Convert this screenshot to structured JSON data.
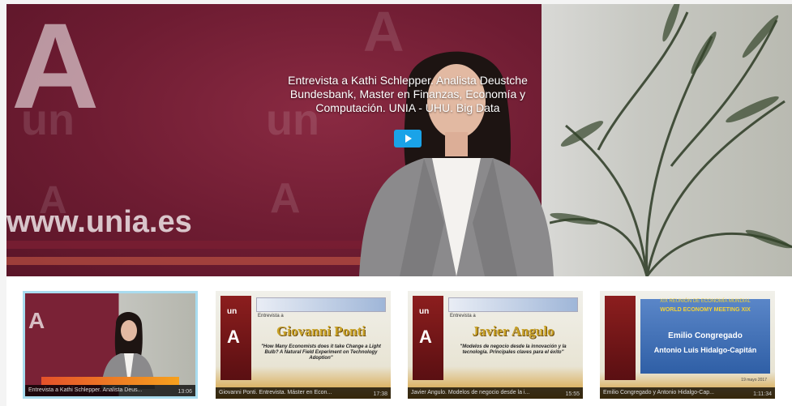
{
  "hero": {
    "title": "Entrevista a Kathi Schlepper. Analista Deustche Bundesbank, Master en Finanzas, Economía y Computación. UNIA - UHU. Big Data",
    "watermark_letter": "A",
    "watermark_un": "un",
    "url": "www.unia.es"
  },
  "thumbnails": [
    {
      "caption": "Entrevista a Kathi Schlepper. Analista Deus...",
      "duration": "13:06"
    },
    {
      "caption": "Giovanni Ponti. Entrevista. Máster en Econ...",
      "duration": "17:38",
      "slide_name": "Giovanni Ponti",
      "slide_intro": "Entrevista a",
      "slide_desc": "\"How Many Economists does it take Change a Light Bulb? A Natural Field Experiment on Technology Adoption\""
    },
    {
      "caption": "Javier Angulo. Modelos de negocio desde la i...",
      "duration": "15:55",
      "slide_name": "Javier Angulo",
      "slide_intro": "Entrevista a",
      "slide_desc": "\"Modelos de negocio desde la innovación y la tecnología. Principales claves para el éxito\""
    },
    {
      "caption": "Emilio Congregado y Antonio Hidalgo-Cap...",
      "duration": "1:11:34",
      "slide_header": "XIX REUNIÓN DE ECONOMÍA MUNDIAL",
      "slide_sub": "WORLD ECONOMY MEETING XIX",
      "slide_name1": "Emilio Congregado",
      "slide_name2": "Antonio Luis Hidalgo-Capitán",
      "slide_date": "19 mayo 2017"
    }
  ],
  "colors": {
    "accent": "#1aa3e8",
    "brand": "#6b1a2e",
    "active_border": "#a9dcef"
  }
}
